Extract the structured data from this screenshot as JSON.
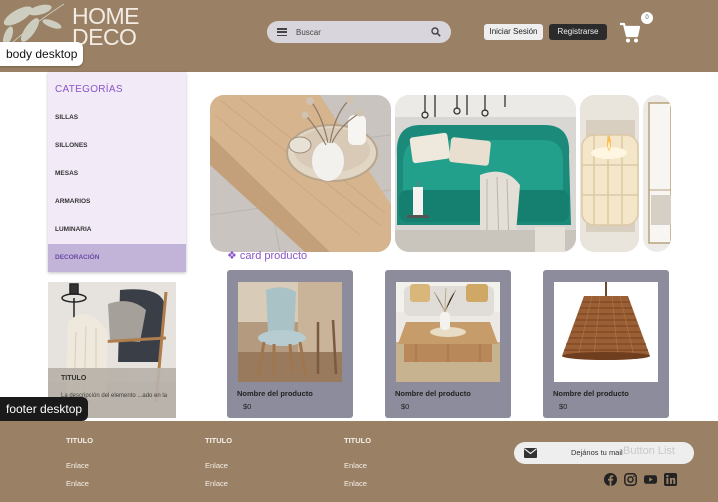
{
  "header": {
    "logo_line1": "HOME",
    "logo_line2": "DECO",
    "search_placeholder": "Buscar",
    "login_label": "Iniciar Sesión",
    "register_label": "Registrarse",
    "cart_count": "0"
  },
  "annotations": {
    "body": "body desktop",
    "footer": "footer desktop",
    "card_section": "❖ card producto"
  },
  "sidebar": {
    "title": "CATEGORÍAS",
    "items": [
      {
        "label": "SILLAS",
        "active": false
      },
      {
        "label": "SILLONES",
        "active": false
      },
      {
        "label": "MESAS",
        "active": false
      },
      {
        "label": "ARMARIOS",
        "active": false
      },
      {
        "label": "LUMINARIA",
        "active": false
      },
      {
        "label": "DECORACIÓN",
        "active": true
      }
    ]
  },
  "products": [
    {
      "name": "Nombre del producto",
      "price": "$0",
      "image": "chair-photo"
    },
    {
      "name": "Nombre del producto",
      "price": "$0",
      "image": "coffee-table-photo"
    },
    {
      "name": "Nombre del producto",
      "price": "$0",
      "image": "pendant-lamp-photo"
    }
  ],
  "promo": {
    "title": "TITULO",
    "description": "La descripción del elemento ...ado en la imagen"
  },
  "footer": {
    "columns": [
      {
        "title": "TITULO",
        "links": [
          "Enlace",
          "Enlace"
        ]
      },
      {
        "title": "TITULO",
        "links": [
          "Enlace",
          "Enlace"
        ]
      },
      {
        "title": "TITULO",
        "links": [
          "Enlace",
          "Enlace"
        ]
      }
    ],
    "newsletter_text": "Dejános tu mail",
    "newsletter_ghost": "Button List",
    "social": [
      "facebook-icon",
      "instagram-icon",
      "youtube-icon",
      "linkedin-icon"
    ]
  },
  "colors": {
    "header_bg": "#9a8064",
    "accent_purple": "#8a55c8",
    "sidebar_bg": "#f2ebf7",
    "sidebar_active": "#c2b3d8",
    "card_bg": "#8c8c9c",
    "button_dark": "#2b2b2b"
  }
}
